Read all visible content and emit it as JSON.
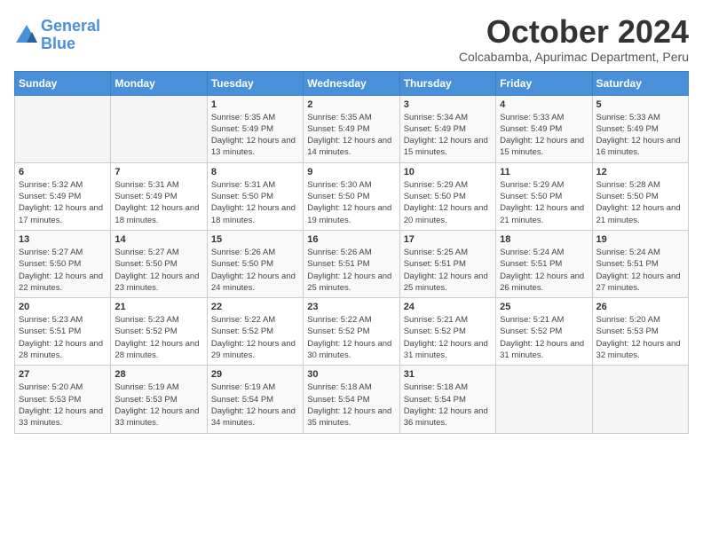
{
  "logo": {
    "line1": "General",
    "line2": "Blue"
  },
  "title": "October 2024",
  "subtitle": "Colcabamba, Apurimac Department, Peru",
  "days_of_week": [
    "Sunday",
    "Monday",
    "Tuesday",
    "Wednesday",
    "Thursday",
    "Friday",
    "Saturday"
  ],
  "weeks": [
    [
      {
        "day": "",
        "info": ""
      },
      {
        "day": "",
        "info": ""
      },
      {
        "day": "1",
        "info": "Sunrise: 5:35 AM\nSunset: 5:49 PM\nDaylight: 12 hours and 13 minutes."
      },
      {
        "day": "2",
        "info": "Sunrise: 5:35 AM\nSunset: 5:49 PM\nDaylight: 12 hours and 14 minutes."
      },
      {
        "day": "3",
        "info": "Sunrise: 5:34 AM\nSunset: 5:49 PM\nDaylight: 12 hours and 15 minutes."
      },
      {
        "day": "4",
        "info": "Sunrise: 5:33 AM\nSunset: 5:49 PM\nDaylight: 12 hours and 15 minutes."
      },
      {
        "day": "5",
        "info": "Sunrise: 5:33 AM\nSunset: 5:49 PM\nDaylight: 12 hours and 16 minutes."
      }
    ],
    [
      {
        "day": "6",
        "info": "Sunrise: 5:32 AM\nSunset: 5:49 PM\nDaylight: 12 hours and 17 minutes."
      },
      {
        "day": "7",
        "info": "Sunrise: 5:31 AM\nSunset: 5:49 PM\nDaylight: 12 hours and 18 minutes."
      },
      {
        "day": "8",
        "info": "Sunrise: 5:31 AM\nSunset: 5:50 PM\nDaylight: 12 hours and 18 minutes."
      },
      {
        "day": "9",
        "info": "Sunrise: 5:30 AM\nSunset: 5:50 PM\nDaylight: 12 hours and 19 minutes."
      },
      {
        "day": "10",
        "info": "Sunrise: 5:29 AM\nSunset: 5:50 PM\nDaylight: 12 hours and 20 minutes."
      },
      {
        "day": "11",
        "info": "Sunrise: 5:29 AM\nSunset: 5:50 PM\nDaylight: 12 hours and 21 minutes."
      },
      {
        "day": "12",
        "info": "Sunrise: 5:28 AM\nSunset: 5:50 PM\nDaylight: 12 hours and 21 minutes."
      }
    ],
    [
      {
        "day": "13",
        "info": "Sunrise: 5:27 AM\nSunset: 5:50 PM\nDaylight: 12 hours and 22 minutes."
      },
      {
        "day": "14",
        "info": "Sunrise: 5:27 AM\nSunset: 5:50 PM\nDaylight: 12 hours and 23 minutes."
      },
      {
        "day": "15",
        "info": "Sunrise: 5:26 AM\nSunset: 5:50 PM\nDaylight: 12 hours and 24 minutes."
      },
      {
        "day": "16",
        "info": "Sunrise: 5:26 AM\nSunset: 5:51 PM\nDaylight: 12 hours and 25 minutes."
      },
      {
        "day": "17",
        "info": "Sunrise: 5:25 AM\nSunset: 5:51 PM\nDaylight: 12 hours and 25 minutes."
      },
      {
        "day": "18",
        "info": "Sunrise: 5:24 AM\nSunset: 5:51 PM\nDaylight: 12 hours and 26 minutes."
      },
      {
        "day": "19",
        "info": "Sunrise: 5:24 AM\nSunset: 5:51 PM\nDaylight: 12 hours and 27 minutes."
      }
    ],
    [
      {
        "day": "20",
        "info": "Sunrise: 5:23 AM\nSunset: 5:51 PM\nDaylight: 12 hours and 28 minutes."
      },
      {
        "day": "21",
        "info": "Sunrise: 5:23 AM\nSunset: 5:52 PM\nDaylight: 12 hours and 28 minutes."
      },
      {
        "day": "22",
        "info": "Sunrise: 5:22 AM\nSunset: 5:52 PM\nDaylight: 12 hours and 29 minutes."
      },
      {
        "day": "23",
        "info": "Sunrise: 5:22 AM\nSunset: 5:52 PM\nDaylight: 12 hours and 30 minutes."
      },
      {
        "day": "24",
        "info": "Sunrise: 5:21 AM\nSunset: 5:52 PM\nDaylight: 12 hours and 31 minutes."
      },
      {
        "day": "25",
        "info": "Sunrise: 5:21 AM\nSunset: 5:52 PM\nDaylight: 12 hours and 31 minutes."
      },
      {
        "day": "26",
        "info": "Sunrise: 5:20 AM\nSunset: 5:53 PM\nDaylight: 12 hours and 32 minutes."
      }
    ],
    [
      {
        "day": "27",
        "info": "Sunrise: 5:20 AM\nSunset: 5:53 PM\nDaylight: 12 hours and 33 minutes."
      },
      {
        "day": "28",
        "info": "Sunrise: 5:19 AM\nSunset: 5:53 PM\nDaylight: 12 hours and 33 minutes."
      },
      {
        "day": "29",
        "info": "Sunrise: 5:19 AM\nSunset: 5:54 PM\nDaylight: 12 hours and 34 minutes."
      },
      {
        "day": "30",
        "info": "Sunrise: 5:18 AM\nSunset: 5:54 PM\nDaylight: 12 hours and 35 minutes."
      },
      {
        "day": "31",
        "info": "Sunrise: 5:18 AM\nSunset: 5:54 PM\nDaylight: 12 hours and 36 minutes."
      },
      {
        "day": "",
        "info": ""
      },
      {
        "day": "",
        "info": ""
      }
    ]
  ]
}
